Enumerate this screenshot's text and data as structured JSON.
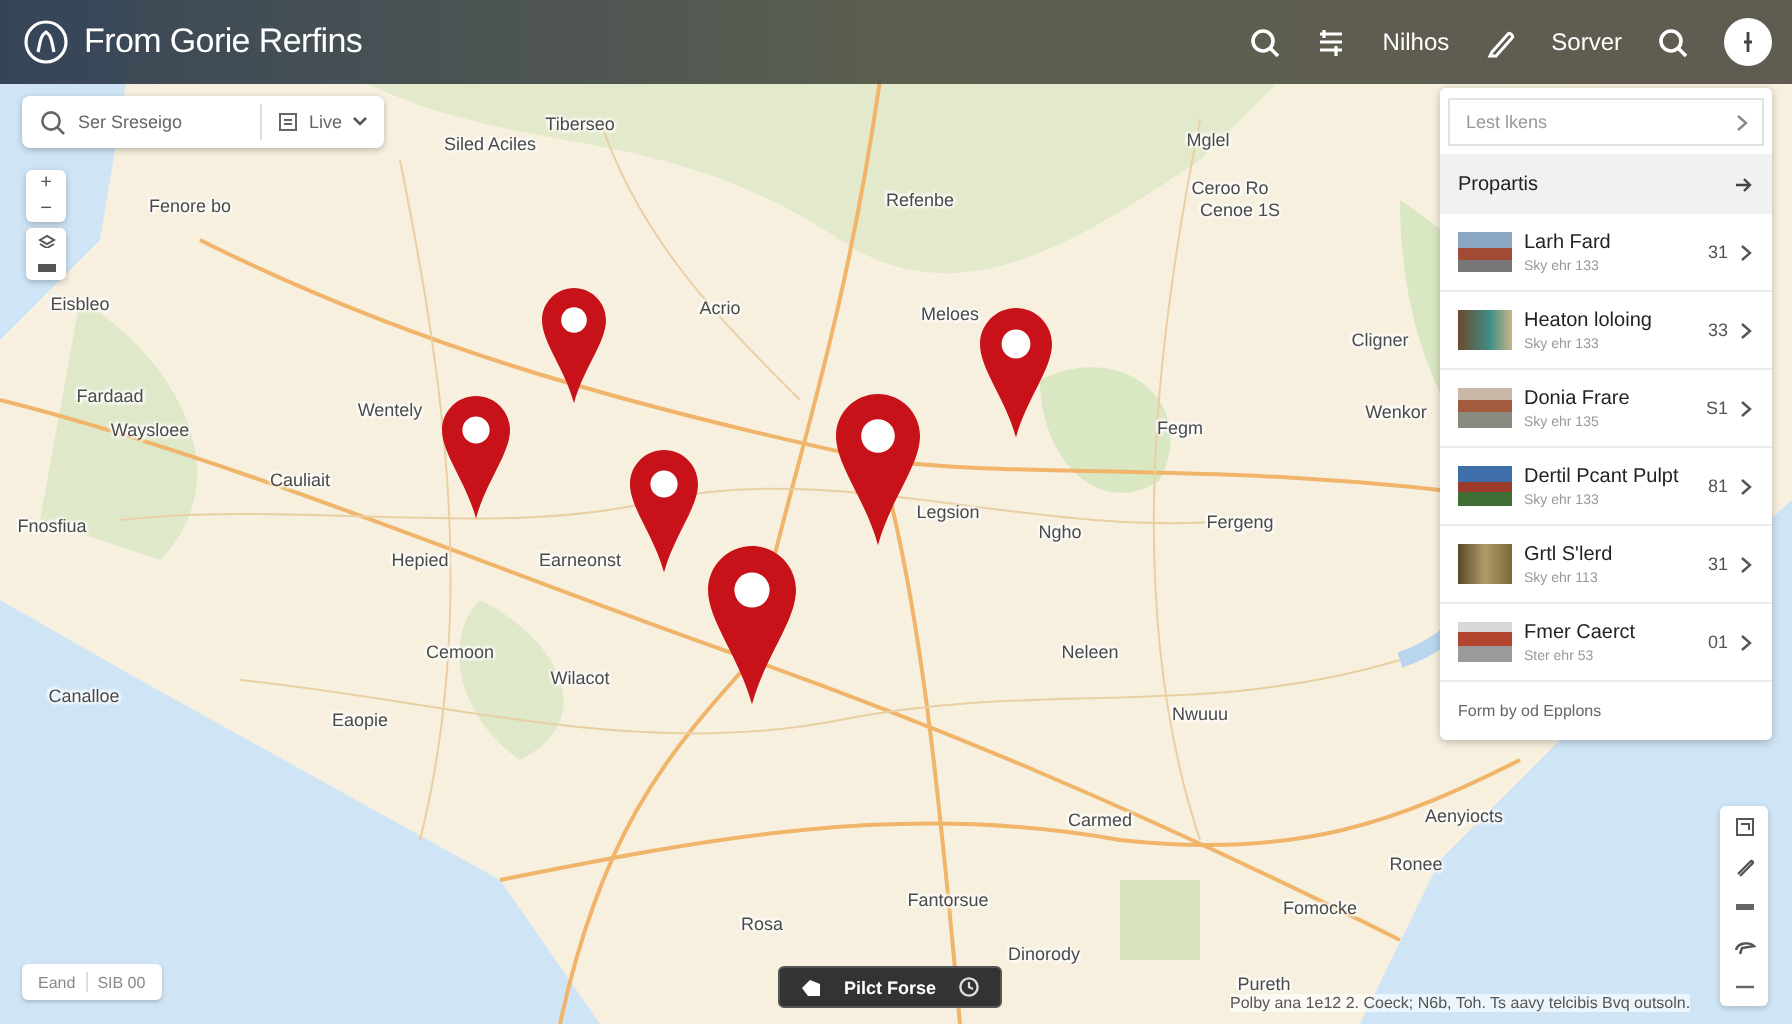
{
  "header": {
    "title": "From Gorie Rerfins",
    "links": [
      "Nilhos",
      "Sorver"
    ]
  },
  "search": {
    "placeholder": "Ser Sreseigo",
    "filter_label": "Live"
  },
  "zoom_controls": {
    "zoom_in": "+",
    "zoom_out": "−"
  },
  "map": {
    "labels": [
      {
        "text": "Tiberseo"
      },
      {
        "text": "Siled Aciles"
      },
      {
        "text": "Mglel"
      },
      {
        "text": "Fenore bo"
      },
      {
        "text": "Refenbe"
      },
      {
        "text": "Ceroo Ro"
      },
      {
        "text": "Cenoe 1S"
      },
      {
        "text": "Eisbleo"
      },
      {
        "text": "Acrio"
      },
      {
        "text": "Meloes"
      },
      {
        "text": "Cligner"
      },
      {
        "text": "Fardaad"
      },
      {
        "text": "Wentely"
      },
      {
        "text": "Waysloee"
      },
      {
        "text": "Fegm"
      },
      {
        "text": "Wenkor"
      },
      {
        "text": "Fnosfiua"
      },
      {
        "text": "Cauliait"
      },
      {
        "text": "Legsion"
      },
      {
        "text": "Ngho"
      },
      {
        "text": "Fergeng"
      },
      {
        "text": "Hepied"
      },
      {
        "text": "Earneonst"
      },
      {
        "text": "Cemoon"
      },
      {
        "text": "Wilacot"
      },
      {
        "text": "Neleen"
      },
      {
        "text": "Canalloe"
      },
      {
        "text": "Eaopie"
      },
      {
        "text": "Nwuuu"
      },
      {
        "text": "Carmed"
      },
      {
        "text": "Aenyiocts"
      },
      {
        "text": "Ronee"
      },
      {
        "text": "Rosa"
      },
      {
        "text": "Fantorsue"
      },
      {
        "text": "Fomocke"
      },
      {
        "text": "Dinorody"
      },
      {
        "text": "Pureth"
      }
    ]
  },
  "panel": {
    "field_placeholder": "Lest lkens",
    "section_title": "Propartis",
    "items": [
      {
        "title": "Larh Fard",
        "subtitle": "Sky ehr 133",
        "price": "31"
      },
      {
        "title": "Heaton loloing",
        "subtitle": "Sky ehr 133",
        "price": "33"
      },
      {
        "title": "Donia Frare",
        "subtitle": "Sky ehr 135",
        "price": "S1"
      },
      {
        "title": "Dertil Pcant Pulpt",
        "subtitle": "Sky ehr 133",
        "price": "81"
      },
      {
        "title": "Grtl S'lerd",
        "subtitle": "Sky ehr 113",
        "price": "31"
      },
      {
        "title": "Fmer Caerct",
        "subtitle": "Ster ehr 53",
        "price": "01"
      }
    ],
    "footer": "Form by od Epplons"
  },
  "scale": {
    "label": "Eand",
    "value": "SIB 00"
  },
  "action_button": {
    "label": "Pilct Forse"
  },
  "attribution": "Polby ana 1e12 2. Coeck; N6b, Toh. Ts aavy telcibis Bvq outsoln."
}
